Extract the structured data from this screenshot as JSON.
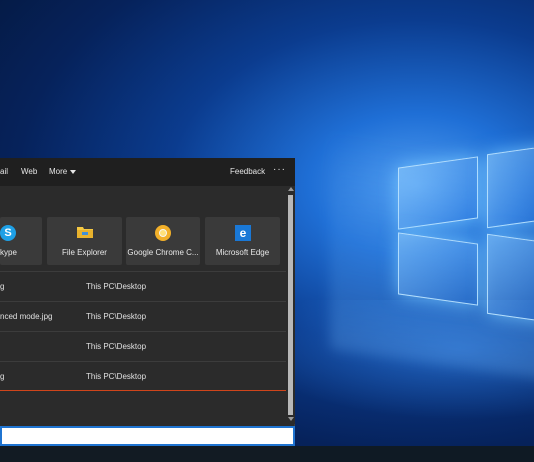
{
  "header": {
    "tabs": [
      {
        "label": "ail"
      },
      {
        "label": "Web"
      },
      {
        "label": "More"
      }
    ],
    "feedback_label": "Feedback",
    "more_options": "···"
  },
  "apps": [
    {
      "name": "kype",
      "icon": "skype-icon",
      "color": "#1ea0e6"
    },
    {
      "name": "File Explorer",
      "icon": "folder-icon",
      "color": "#f5c842"
    },
    {
      "name": "Google Chrome C...",
      "icon": "chrome-icon",
      "color": "#f2b02a"
    },
    {
      "name": "Microsoft Edge",
      "icon": "edge-icon",
      "color": "#1a78d6"
    }
  ],
  "files": [
    {
      "name": "g",
      "path": "This PC\\Desktop"
    },
    {
      "name": "nced mode.jpg",
      "path": "This PC\\Desktop"
    },
    {
      "name": "",
      "path": "This PC\\Desktop"
    },
    {
      "name": "g",
      "path": "This PC\\Desktop"
    }
  ],
  "search": {
    "value": "",
    "placeholder": ""
  },
  "colors": {
    "accent": "#1f74d1",
    "panel": "#2b2b2b",
    "header": "#1f1f1f",
    "tile": "#3a3a3a",
    "selection": "#d0451b"
  }
}
